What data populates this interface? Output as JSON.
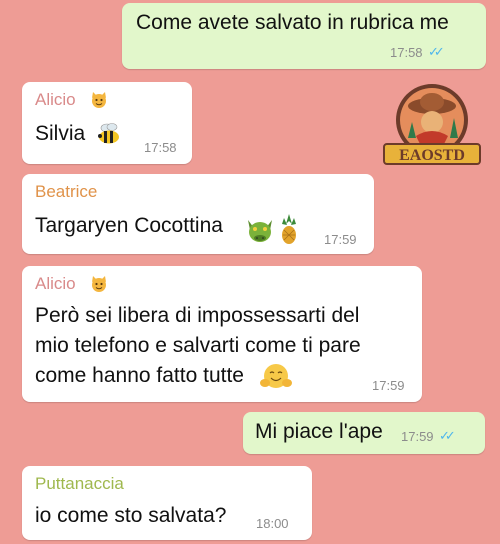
{
  "colors": {
    "background": "#EE9C95",
    "outgoing_bubble": "#E2F7CB",
    "incoming_bubble": "#FFFFFF",
    "read_ticks": "#4FB6EC",
    "alicio_name": "#D98A8A",
    "beatrice_name": "#E0934A",
    "puttanaccia_name": "#9FB84E"
  },
  "watermark": {
    "text": "EAOSTD"
  },
  "messages": [
    {
      "type": "outgoing",
      "text": "Come avete salvato in rubrica me",
      "time": "17:58",
      "ticks": "✓✓"
    },
    {
      "type": "incoming",
      "sender": "Alicio",
      "sender_icon": "cat-face-icon",
      "text": "Silvia",
      "text_icon": "bee-icon",
      "time": "17:58"
    },
    {
      "type": "incoming",
      "sender": "Beatrice",
      "text": "Targaryen Cocottina",
      "text_icons": [
        "dragon-face-icon",
        "pineapple-icon"
      ],
      "time": "17:59"
    },
    {
      "type": "incoming",
      "sender": "Alicio",
      "sender_icon": "cat-face-icon",
      "line1": "Però sei libera di impossessarti del",
      "line2": "mio telefono e salvarti come ti pare",
      "line3": "come hanno fatto tutte",
      "text_icon": "hugging-face-icon",
      "time": "17:59"
    },
    {
      "type": "outgoing",
      "text": "Mi piace l'ape",
      "time": "17:59",
      "ticks": "✓✓"
    },
    {
      "type": "incoming",
      "sender": "Puttanaccia",
      "text": "io come sto salvata?",
      "time": "18:00"
    }
  ]
}
